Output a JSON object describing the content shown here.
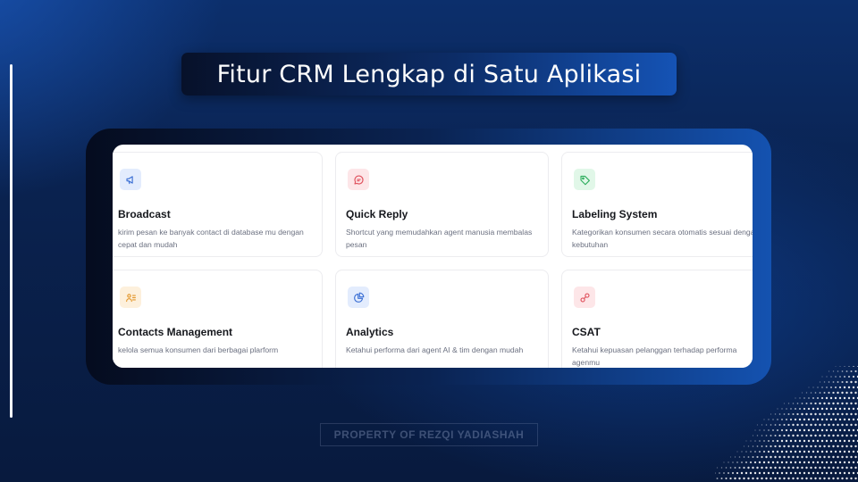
{
  "title": "Fitur CRM Lengkap di Satu Aplikasi",
  "features": [
    {
      "title": "Broadcast",
      "description": "kirim pesan ke banyak contact di database mu dengan cepat dan mudah",
      "icon": "megaphone-icon",
      "accent": "#3b6fd4",
      "tint": "#e3ecfd"
    },
    {
      "title": "Quick Reply",
      "description": "Shortcut yang memudahkan agent manusia membalas pesan",
      "icon": "chat-bubble-icon",
      "accent": "#e0525e",
      "tint": "#fde6e8"
    },
    {
      "title": "Labeling System",
      "description": "Kategorikan konsumen secara otomatis sesuai dengan kebutuhan",
      "icon": "tag-icon",
      "accent": "#2fae5e",
      "tint": "#e1f7e8"
    },
    {
      "title": "Contacts Management",
      "description": "kelola semua konsumen dari berbagai plarform",
      "icon": "contacts-icon",
      "accent": "#e3962b",
      "tint": "#fdf0dc"
    },
    {
      "title": "Analytics",
      "description": "Ketahui performa dari agent AI & tim dengan mudah",
      "icon": "pie-chart-icon",
      "accent": "#3b6fd4",
      "tint": "#e3ecfd"
    },
    {
      "title": "CSAT",
      "description": "Ketahui kepuasan pelanggan terhadap performa agenmu",
      "icon": "satisfaction-icon",
      "accent": "#e0525e",
      "tint": "#fde6e8"
    }
  ],
  "watermark": "PROPERTY OF REZQI YADIASHAH"
}
